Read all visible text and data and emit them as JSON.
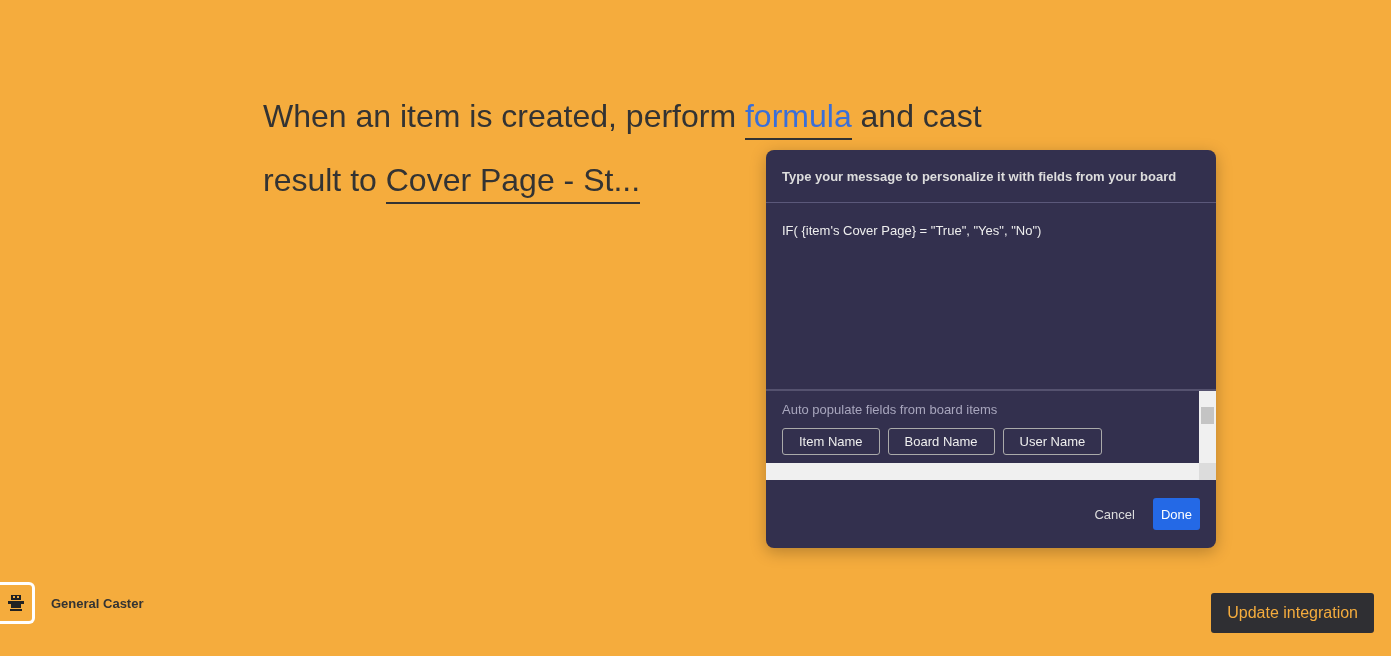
{
  "recipe": {
    "parts": [
      {
        "kind": "text",
        "text": "When an item is created, perform "
      },
      {
        "kind": "field",
        "text": "formula"
      },
      {
        "kind": "text",
        "text": " and cast result to "
      },
      {
        "kind": "value",
        "text": "Cover Page - St..."
      }
    ]
  },
  "dialog": {
    "title": "Type your message to personalize it with fields from your board",
    "message": "IF( {item's Cover Page} = \"True\", \"Yes\", \"No\")",
    "autopopulate_label": "Auto populate fields from board items",
    "chips": [
      "Item Name",
      "Board Name",
      "User Name"
    ],
    "buttons": [
      {
        "label": "Cancel",
        "kind": "secondary"
      },
      {
        "label": "Done",
        "kind": "primary"
      }
    ]
  },
  "footer": {
    "app_name": "General Caster",
    "button": "Update integration"
  }
}
